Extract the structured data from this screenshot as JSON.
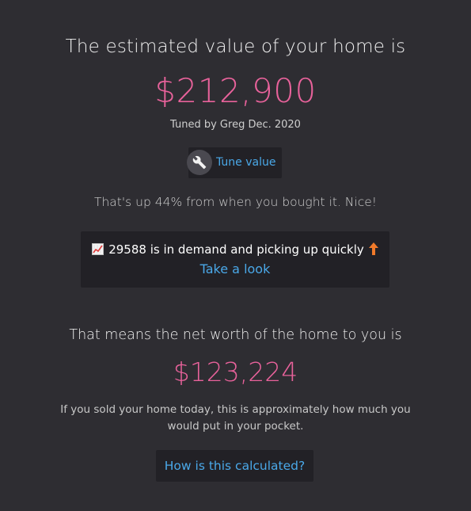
{
  "header": {
    "title": "The estimated value of your home is",
    "estimated_value": "$212,900",
    "tuned_by": "Tuned by Greg Dec. 2020"
  },
  "tune_button": {
    "label": "Tune value",
    "icon": "wrench-icon"
  },
  "appreciation": {
    "text": "That's up 44% from when you bought it. Nice!"
  },
  "demand": {
    "icon_left": "chart-increasing-icon",
    "text": "29588 is in demand and picking up quickly",
    "icon_right": "arrow-up-icon",
    "link": "Take a look"
  },
  "net_worth": {
    "title": "That means the net worth of the home to you is",
    "value": "$123,224",
    "explanation": "If you sold your home today, this is approximately how much you would put in your pocket."
  },
  "calc_button": {
    "label": "How is this calculated?"
  },
  "colors": {
    "background": "#2e2d32",
    "panel": "#222126",
    "accent_pink": "#e8629b",
    "link_blue": "#4aa8e8",
    "arrow_orange": "#f07a2a"
  }
}
